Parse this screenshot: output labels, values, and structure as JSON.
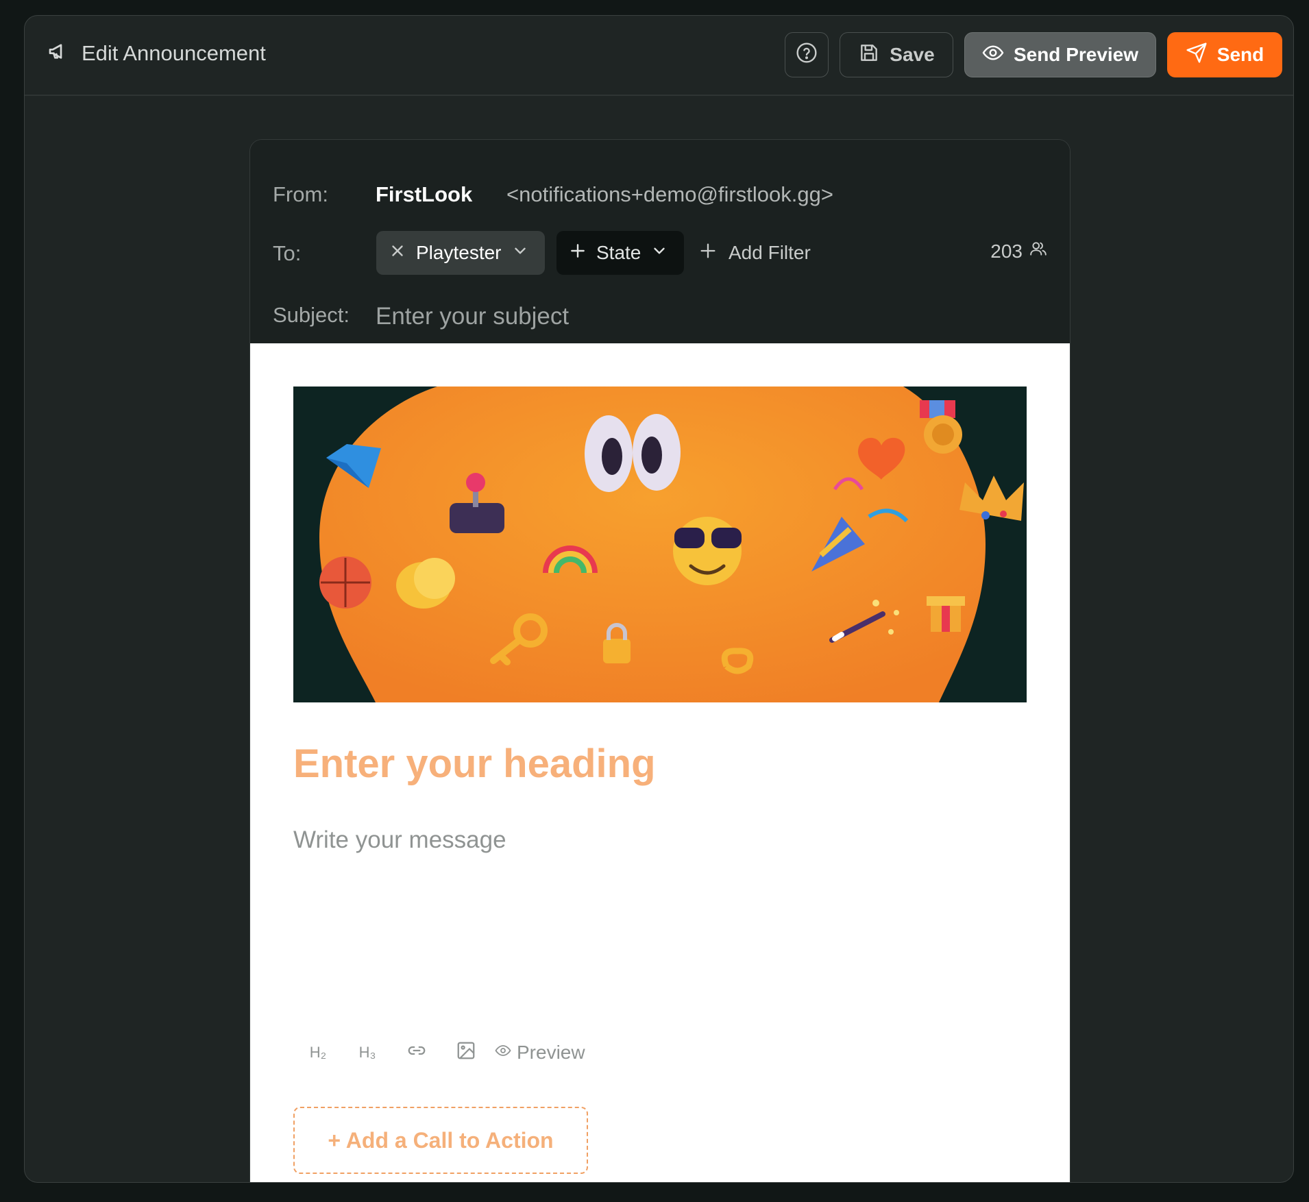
{
  "topbar": {
    "title": "Edit Announcement",
    "title_icon": "megaphone-icon",
    "help_icon": "help-circle-icon",
    "save_label": "Save",
    "send_preview_label": "Send Preview",
    "send_label": "Send"
  },
  "email": {
    "from_label": "From:",
    "from_name": "FirstLook",
    "from_email": "<notifications+demo@firstlook.gg>",
    "to_label": "To:",
    "filters": [
      {
        "label": "Playtester",
        "removable": true
      },
      {
        "label": "State",
        "removable": false
      }
    ],
    "add_filter_label": "Add Filter",
    "recipient_count": "203",
    "subject_label": "Subject:",
    "subject_placeholder": "Enter your subject"
  },
  "content": {
    "banner_alt": "emoji banner",
    "heading_placeholder": "Enter your heading",
    "message_placeholder": "Write your message",
    "toolbar": {
      "h2": "H₂",
      "h3": "H₃",
      "preview": "Preview"
    },
    "cta_label": "+ Add a Call to Action"
  },
  "colors": {
    "accent": "#ff6a13",
    "heading_placeholder": "#f7b07a"
  }
}
